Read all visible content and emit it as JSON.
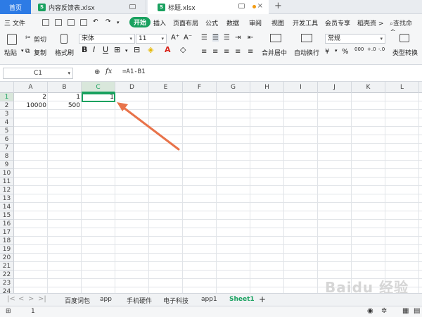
{
  "tabs": [
    {
      "label": "首页"
    },
    {
      "label": "内容反馈表.xlsx"
    },
    {
      "label": "标题.xlsx"
    }
  ],
  "menu": [
    "三 文件",
    "开始",
    "插入",
    "页面布局",
    "公式",
    "数据",
    "审阅",
    "视图",
    "开发工具",
    "会员专享",
    "稻壳资 >",
    "查找命令..."
  ],
  "toolbar": {
    "paste": "粘贴",
    "cut": "剪切",
    "copy": "复制",
    "format_painter": "格式刷",
    "font_name": "宋体",
    "font_size": "11",
    "merge_center": "合并居中",
    "wrap_text": "自动换行",
    "number_format": "常规",
    "type_convert": "类型转换",
    "currency": "¥",
    "percent": "%"
  },
  "formula_bar": {
    "name_box": "C1",
    "fx": "fx",
    "formula": "=A1-B1"
  },
  "columns": [
    "A",
    "B",
    "C",
    "D",
    "E",
    "F",
    "G",
    "H",
    "I",
    "J",
    "K",
    "L"
  ],
  "rows": [
    "1",
    "2",
    "3",
    "4",
    "5",
    "6",
    "7",
    "8",
    "9",
    "10",
    "11",
    "12",
    "13",
    "14",
    "15",
    "16",
    "17",
    "18",
    "19",
    "20",
    "21",
    "22",
    "23",
    "24",
    "25"
  ],
  "cells": {
    "A1": "2",
    "B1": "1",
    "C1": "1",
    "A2": "10000",
    "B2": "500"
  },
  "sheets": [
    "百度词包",
    "app",
    "手机硬件",
    "电子科技",
    "app1",
    "Sheet1"
  ],
  "active_sheet": "Sheet1",
  "status": {
    "page": "1"
  },
  "watermark": "Baidu 经验",
  "colors": {
    "accent": "#19a15f",
    "annotation_arrow": "#e8734a",
    "home_tab": "#2d7be5"
  }
}
